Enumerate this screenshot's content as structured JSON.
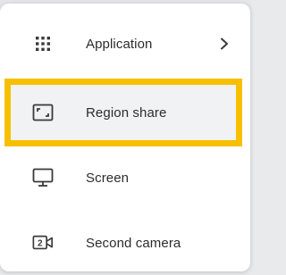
{
  "menu": {
    "items": [
      {
        "label": "Application",
        "icon": "grid-icon",
        "has_submenu": true
      },
      {
        "label": "Region share",
        "icon": "region-share-icon",
        "highlighted": true
      },
      {
        "label": "Screen",
        "icon": "monitor-icon"
      },
      {
        "label": "Second camera",
        "icon": "second-camera-icon"
      }
    ]
  },
  "colors": {
    "highlight_border": "#f6c000",
    "highlight_background": "#f1f2f4",
    "text": "#2c2c2c",
    "icon": "#3a3a3a"
  }
}
